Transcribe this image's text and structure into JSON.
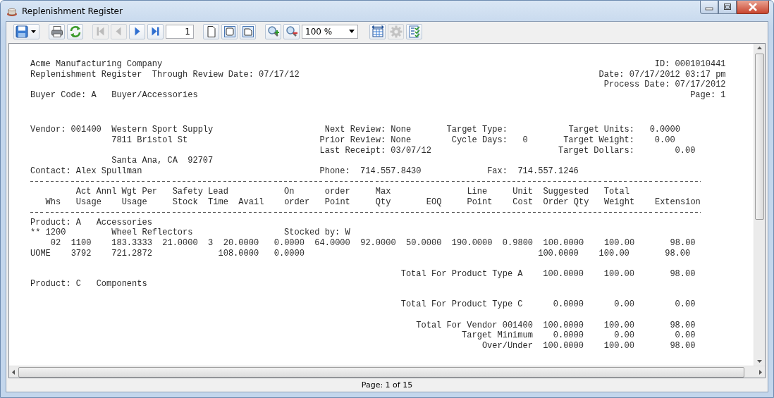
{
  "window": {
    "title": "Replenishment Register"
  },
  "toolbar": [
    {
      "kind": "save",
      "disabled": false
    },
    {
      "kind": "print",
      "disabled": false
    },
    {
      "kind": "refresh",
      "disabled": false
    },
    {
      "kind": "first",
      "disabled": true
    },
    {
      "kind": "prev",
      "disabled": true
    },
    {
      "kind": "next",
      "disabled": false
    },
    {
      "kind": "last",
      "disabled": false
    },
    {
      "kind": "page_field",
      "value": "1",
      "disabled": false
    },
    {
      "kind": "single_page",
      "disabled": false
    },
    {
      "kind": "page_width",
      "disabled": false
    },
    {
      "kind": "whole_page",
      "disabled": false
    },
    {
      "kind": "zoom_in",
      "disabled": false
    },
    {
      "kind": "zoom_out",
      "disabled": false
    },
    {
      "kind": "zoom_combo",
      "value": "100 %",
      "disabled": false
    },
    {
      "kind": "fit_width",
      "disabled": false
    },
    {
      "kind": "settings",
      "disabled": true
    },
    {
      "kind": "checklist",
      "disabled": false
    }
  ],
  "report": {
    "header": [
      {
        "left": "Acme Manufacturing Company",
        "right": "ID: 0001010441"
      },
      {
        "left": "Replenishment Register  Through Review Date: 07/17/12",
        "right": "Date: 07/17/2012 03:17 pm"
      },
      {
        "right": "Process Date: 07/17/2012"
      },
      {
        "left": "Buyer Code: A   Buyer/Accessories",
        "right": "Page: 1"
      }
    ],
    "blocks": [
      [
        {
          "kind": "text",
          "text": "Vendor: 001400  Western Sport Supply                      Next Review: None       Target Type:            Target Units:   0.0000"
        },
        {
          "kind": "text",
          "text": "                7811 Bristol St                          Prior Review: None        Cycle Days:   0       Target Weight:    0.00"
        },
        {
          "kind": "text",
          "text": "                                                         Last Receipt: 03/07/12                         Target Dollars:        0.00"
        },
        {
          "kind": "text",
          "text": "                Santa Ana, CA  92707"
        },
        {
          "kind": "text",
          "text": "Contact: Alex Spullman                                   Phone:  714.557.8430             Fax:  714.557.1246"
        },
        {
          "kind": "rule"
        },
        {
          "kind": "text",
          "text": "         Act Annl Wgt Per   Safety Lead           On      order     Max               Line     Unit  Suggested   Total"
        },
        {
          "kind": "text",
          "text": "   Whs   Usage    Usage     Stock  Time  Avail    order   Point     Qty       EOQ     Point    Cost  Order Qty   Weight    Extension"
        },
        {
          "kind": "rule"
        },
        {
          "kind": "text",
          "text": "Product: A   Accessories"
        },
        {
          "kind": "text",
          "text": "** 1200         Wheel Reflectors                  Stocked by: W"
        },
        {
          "kind": "text",
          "text": "    02  1100    183.3333  21.0000  3  20.0000   0.0000  64.0000  92.0000  50.0000  190.0000  0.9800  100.0000    100.00       98.00"
        },
        {
          "kind": "text",
          "text": "UOME    3792    721.2872             108.0000   0.0000                                              100.0000    100.00       98.00"
        }
      ],
      [
        {
          "kind": "text",
          "text": "                                                                         Total For Product Type A    100.0000    100.00       98.00"
        },
        {
          "kind": "text",
          "text": "Product: C   Components"
        }
      ],
      [
        {
          "kind": "text",
          "text": "                                                                         Total For Product Type C      0.0000      0.00        0.00"
        }
      ],
      [
        {
          "kind": "text",
          "text": "                                                                            Total For Vendor 001400  100.0000    100.00       98.00"
        },
        {
          "kind": "text",
          "text": "                                                                                     Target Minimum    0.0000      0.00        0.00"
        },
        {
          "kind": "text",
          "text": "                                                                                         Over/Under  100.0000    100.00       98.00"
        }
      ]
    ]
  },
  "status_bar": {
    "text": "Page: 1 of 15"
  }
}
